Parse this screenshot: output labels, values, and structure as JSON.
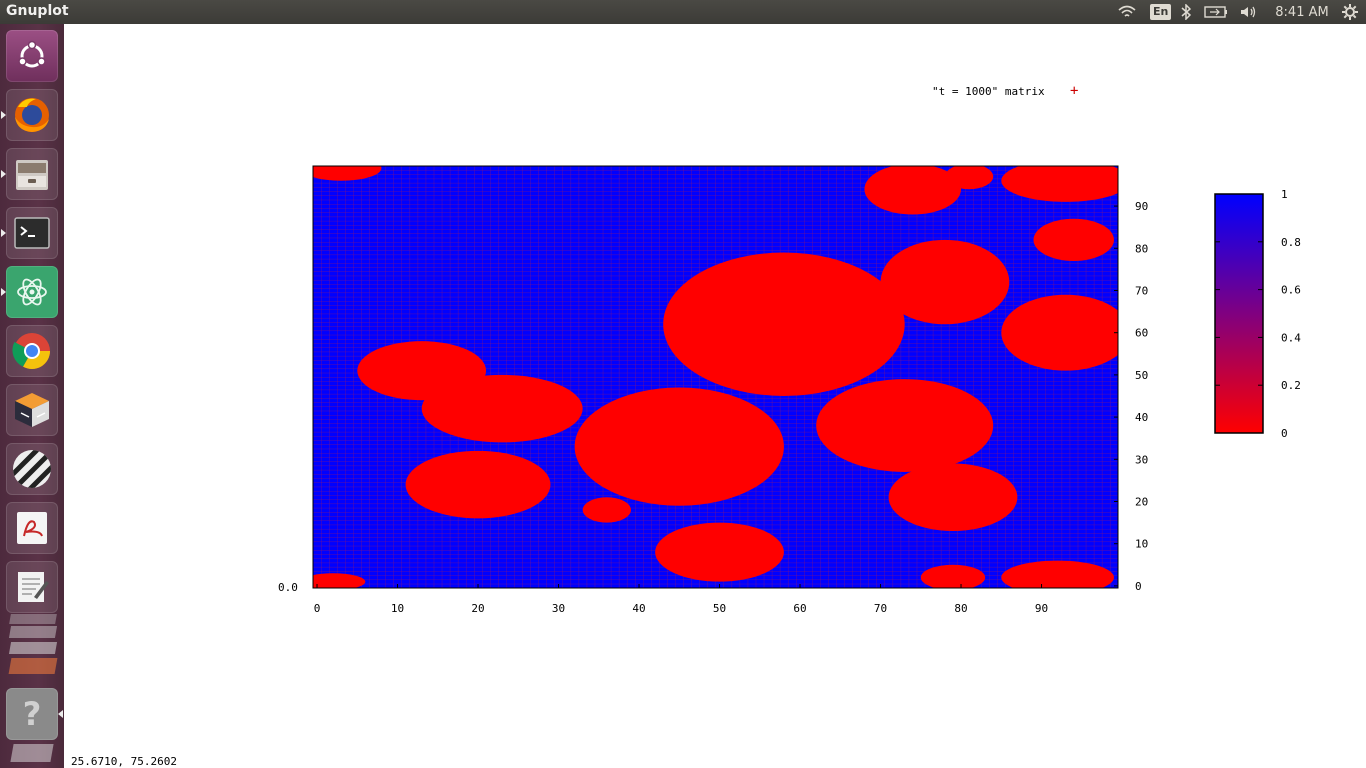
{
  "window": {
    "app_title": "Gnuplot"
  },
  "panel": {
    "language": "En",
    "clock": "8:41 AM",
    "icons": [
      "wifi-icon",
      "language-indicator",
      "bluetooth-icon",
      "battery-icon",
      "volume-icon",
      "clock",
      "settings-gear-icon"
    ]
  },
  "launcher": {
    "items": [
      {
        "name": "ubuntu-dash",
        "icon": "ubuntu-logo-icon"
      },
      {
        "name": "firefox",
        "icon": "firefox-icon"
      },
      {
        "name": "files",
        "icon": "file-cabinet-icon"
      },
      {
        "name": "terminal",
        "icon": "terminal-icon"
      },
      {
        "name": "atom",
        "icon": "atom-icon"
      },
      {
        "name": "chrome",
        "icon": "chrome-icon"
      },
      {
        "name": "virtualbox",
        "icon": "virtualbox-icon"
      },
      {
        "name": "striped-app",
        "icon": "striped-icon"
      },
      {
        "name": "document-viewer",
        "icon": "pdf-viewer-icon"
      },
      {
        "name": "text-editor",
        "icon": "text-editor-icon"
      },
      {
        "name": "help",
        "icon": "question-mark-icon"
      }
    ]
  },
  "plot": {
    "legend_text": "\"t = 1000\" matrix",
    "legend_marker": "+",
    "marker_color": "#cc0000",
    "origin_label": "0.0",
    "status_coords": "25.6710,  75.2602"
  },
  "chart_data": {
    "type": "heatmap",
    "title": "",
    "series_name": "\"t = 1000\" matrix",
    "xlabel": "",
    "ylabel": "",
    "xlim": [
      0,
      99
    ],
    "ylim": [
      0,
      99
    ],
    "x_ticks": [
      "0",
      "10",
      "20",
      "30",
      "40",
      "50",
      "60",
      "70",
      "80",
      "90"
    ],
    "y_ticks": [
      "0",
      "10",
      "20",
      "30",
      "40",
      "50",
      "60",
      "70",
      "80",
      "90"
    ],
    "colorbar": {
      "range": [
        0,
        1
      ],
      "ticks": [
        "0",
        "0.2",
        "0.4",
        "0.6",
        "0.8",
        "1"
      ],
      "low_color": "#ff0000",
      "high_color": "#0000ff"
    },
    "background_value": 1,
    "red_regions_value": 0,
    "regions": [
      {
        "cx": 3,
        "cy": 99,
        "rx": 5,
        "ry": 3
      },
      {
        "cx": 74,
        "cy": 94,
        "rx": 6,
        "ry": 6
      },
      {
        "cx": 81,
        "cy": 97,
        "rx": 3,
        "ry": 3
      },
      {
        "cx": 93,
        "cy": 96,
        "rx": 8,
        "ry": 5
      },
      {
        "cx": 94,
        "cy": 82,
        "rx": 5,
        "ry": 5
      },
      {
        "cx": 78,
        "cy": 72,
        "rx": 8,
        "ry": 10
      },
      {
        "cx": 93,
        "cy": 60,
        "rx": 8,
        "ry": 9
      },
      {
        "cx": 58,
        "cy": 62,
        "rx": 15,
        "ry": 17
      },
      {
        "cx": 13,
        "cy": 51,
        "rx": 8,
        "ry": 7
      },
      {
        "cx": 23,
        "cy": 42,
        "rx": 10,
        "ry": 8
      },
      {
        "cx": 45,
        "cy": 33,
        "rx": 13,
        "ry": 14
      },
      {
        "cx": 73,
        "cy": 38,
        "rx": 11,
        "ry": 11
      },
      {
        "cx": 20,
        "cy": 24,
        "rx": 9,
        "ry": 8
      },
      {
        "cx": 79,
        "cy": 21,
        "rx": 8,
        "ry": 8
      },
      {
        "cx": 36,
        "cy": 18,
        "rx": 3,
        "ry": 3
      },
      {
        "cx": 50,
        "cy": 8,
        "rx": 8,
        "ry": 7
      },
      {
        "cx": 79,
        "cy": 2,
        "rx": 4,
        "ry": 3
      },
      {
        "cx": 92,
        "cy": 2,
        "rx": 7,
        "ry": 4
      },
      {
        "cx": 2,
        "cy": 1,
        "rx": 4,
        "ry": 2
      }
    ]
  }
}
